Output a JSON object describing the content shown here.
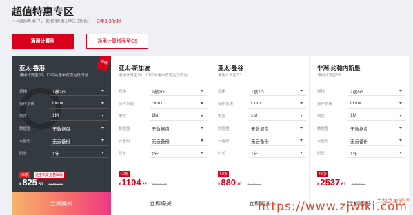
{
  "header": {
    "title": "超值特惠专区",
    "subtitle": "不限新老用户，超值特惠1年3.8折起，",
    "subtitle_highlight": "3年3.3折起"
  },
  "tabs": [
    {
      "label": "通用计算型",
      "active": true
    },
    {
      "label": "通用计算增强型C6",
      "active": false
    }
  ],
  "cards": [
    {
      "region": "亚太-香港",
      "desc": "通用计算型S3，CN2高速带宽稳定低时延",
      "hot_badge": "热销",
      "specs": [
        {
          "label": "规格",
          "value": "1核2G"
        },
        {
          "label": "操作系统",
          "value": "Linux"
        },
        {
          "label": "带宽",
          "value": "1M"
        },
        {
          "label": "数据盘",
          "value": "无数据盘"
        },
        {
          "label": "云备份",
          "value": "无云备份"
        },
        {
          "label": "时长",
          "value": "1年"
        }
      ],
      "discount": "3.8折",
      "promo": "送主机安全基础版",
      "price_currency": "¥",
      "price_int": "825",
      "price_dec": ".60",
      "price_orig": "¥1356.40",
      "buy_label": "立即购买"
    },
    {
      "region": "亚太-新加坡",
      "desc": "通用计算型S6，CN2高速带宽稳定低时延",
      "specs": [
        {
          "label": "规格",
          "value": "1核2G"
        },
        {
          "label": "操作系统",
          "value": "Linux"
        },
        {
          "label": "带宽",
          "value": "1M"
        },
        {
          "label": "数据盘",
          "value": "无数据盘"
        },
        {
          "label": "云备份",
          "value": "无云备份"
        },
        {
          "label": "时长",
          "value": "1年"
        }
      ],
      "discount": "4.0折",
      "price_currency": "¥",
      "price_int": "1104",
      "price_dec": ".22",
      "price_orig": "¥1655.38",
      "buy_label": "立即购买"
    },
    {
      "region": "亚太-曼谷",
      "desc": "通用计算型S3",
      "specs": [
        {
          "label": "规格",
          "value": "1核2G"
        },
        {
          "label": "操作系统",
          "value": "Linux"
        },
        {
          "label": "带宽",
          "value": "1M"
        },
        {
          "label": "数据盘",
          "value": "无数据盘"
        },
        {
          "label": "云备份",
          "value": "无云备份"
        },
        {
          "label": "时长",
          "value": "1年"
        }
      ],
      "discount": "4.0折",
      "price_currency": "¥",
      "price_int": "880",
      "price_dec": ".20",
      "price_orig": "¥1320.37",
      "buy_label": "立即购买"
    },
    {
      "region": "非洲-约翰内斯堡",
      "desc": "通用计算型S3",
      "specs": [
        {
          "label": "规格",
          "value": "2核8G"
        },
        {
          "label": "操作系统",
          "value": "Linux"
        },
        {
          "label": "带宽",
          "value": "1M"
        },
        {
          "label": "数据盘",
          "value": "无数据盘"
        },
        {
          "label": "云备份",
          "value": "无云备份"
        },
        {
          "label": "时长",
          "value": "1年"
        }
      ],
      "discount": "4.0折",
      "price_currency": "¥",
      "price_int": "2537",
      "price_dec": ".61",
      "price_orig": "¥3806.47",
      "buy_label": "立即购买"
    }
  ],
  "watermark": {
    "url": "https://www.zjwiki.com",
    "logo_text": "主机之家测评"
  },
  "colors": {
    "accent": "#d9001b",
    "dark_card": "#333a40",
    "page_bg": "#eef0f5"
  }
}
